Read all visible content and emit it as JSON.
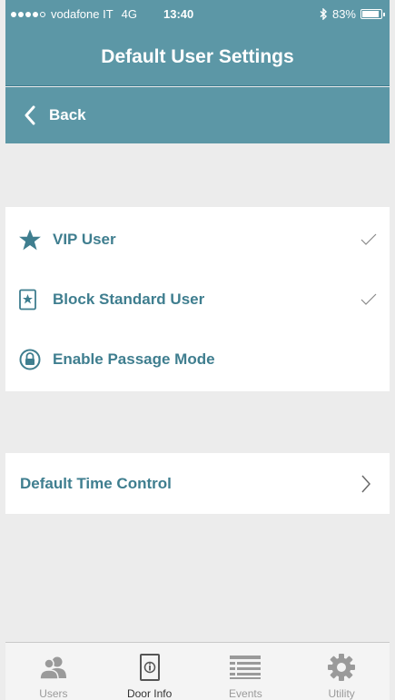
{
  "status_bar": {
    "carrier": "vodafone IT",
    "network": "4G",
    "time": "13:40",
    "battery": "83%"
  },
  "header": {
    "title": "Default User Settings",
    "back_label": "Back"
  },
  "options": [
    {
      "label": "VIP User",
      "icon": "star-icon",
      "checked": true
    },
    {
      "label": "Block Standard User",
      "icon": "star-card-icon",
      "checked": true
    },
    {
      "label": "Enable Passage Mode",
      "icon": "lock-circle-icon",
      "checked": false
    }
  ],
  "time_control": {
    "label": "Default Time Control"
  },
  "tab_bar": {
    "tabs": [
      {
        "label": "Users",
        "icon": "users-icon",
        "active": false
      },
      {
        "label": "Door Info",
        "icon": "door-info-icon",
        "active": true
      },
      {
        "label": "Events",
        "icon": "events-list-icon",
        "active": false
      },
      {
        "label": "Utility",
        "icon": "gear-icon",
        "active": false
      }
    ]
  },
  "colors": {
    "header_bg": "#5c97a6",
    "label_text": "#3f7e8f",
    "page_bg": "#ececec",
    "icon_inactive": "#9a9a9a",
    "icon_active": "#555555"
  }
}
